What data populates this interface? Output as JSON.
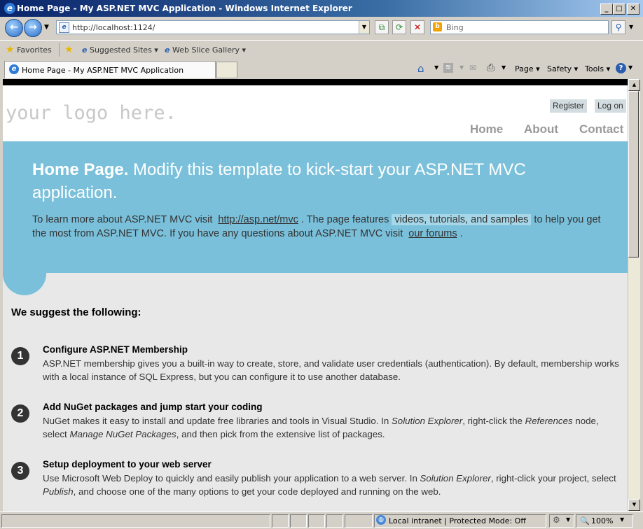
{
  "window": {
    "title": "Home Page - My ASP.NET MVC Application - Windows Internet Explorer",
    "min_glyph": "_",
    "max_glyph": "□",
    "close_glyph": "✕"
  },
  "address_bar": {
    "url": "http://localhost:1124/",
    "search_placeholder": "Bing"
  },
  "favorites_bar": {
    "favorites_label": "Favorites",
    "suggested_sites": "Suggested Sites ▾",
    "web_slice_gallery": "Web Slice Gallery ▾"
  },
  "tab": {
    "label": "Home Page - My ASP.NET MVC Application"
  },
  "command_bar": {
    "page": "Page ▾",
    "safety": "Safety ▾",
    "tools": "Tools ▾"
  },
  "site": {
    "logo": "your logo here.",
    "register": "Register",
    "login": "Log on",
    "nav": [
      "Home",
      "About",
      "Contact"
    ]
  },
  "featured": {
    "title_strong": "Home Page.",
    "title_rest": " Modify this template to kick-start your ASP.NET MVC application.",
    "p1": "To learn more about ASP.NET MVC visit ",
    "link1": "http://asp.net/mvc",
    "p2": ". The page features ",
    "highlight": "videos, tutorials, and samples",
    "p3": " to help you get the most from ASP.NET MVC. If you have any questions about ASP.NET MVC visit ",
    "link2": "our forums",
    "p4": "."
  },
  "suggest_heading": "We suggest the following:",
  "steps": [
    {
      "num": "1",
      "heading": "Configure ASP.NET Membership",
      "text": "ASP.NET membership gives you a built-in way to create, store, and validate user credentials (authentication). By default, membership works with a local instance of SQL Express, but you can configure it to use another database."
    },
    {
      "num": "2",
      "heading": "Add NuGet packages and jump start your coding",
      "t1": "NuGet makes it easy to install and update free libraries and tools in Visual Studio. In ",
      "i1": "Solution Explorer",
      "t2": ", right-click the ",
      "i2": "References",
      "t3": " node, select ",
      "i3": "Manage NuGet Packages",
      "t4": ", and then pick from the extensive list of packages."
    },
    {
      "num": "3",
      "heading": "Setup deployment to your web server",
      "t1": "Use Microsoft Web Deploy to quickly and easily publish your application to a web server. In ",
      "i1": "Solution Explorer",
      "t2": ", right-click your project, select ",
      "i2": "Publish",
      "t3": ", and choose one of the many options to get your code deployed and running on the web."
    }
  ],
  "status_bar": {
    "zone": "Local intranet | Protected Mode: Off",
    "zoom": "100%"
  },
  "colors": {
    "featured_bg": "#7ac0da",
    "nav_text": "#999999",
    "title_bar": "#0a246a"
  }
}
